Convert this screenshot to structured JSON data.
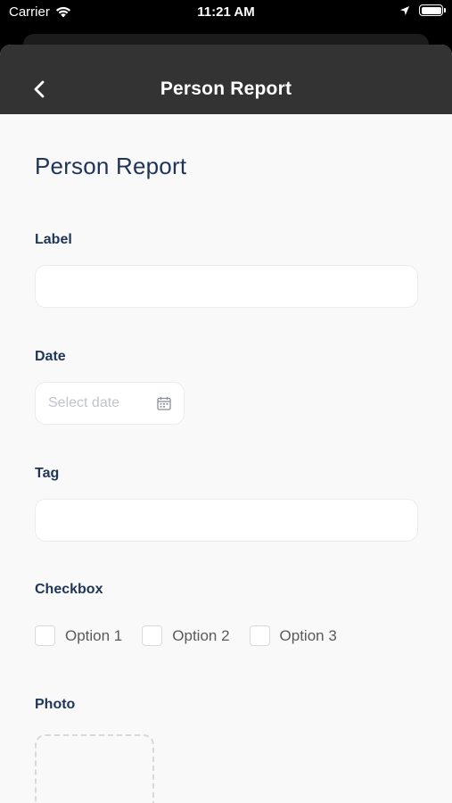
{
  "status_bar": {
    "carrier": "Carrier",
    "time": "11:21 AM"
  },
  "nav": {
    "title": "Person Report",
    "back_icon": "chevron-left-icon"
  },
  "form": {
    "title": "Person Report",
    "label": {
      "label": "Label",
      "value": ""
    },
    "date": {
      "label": "Date",
      "placeholder": "Select date",
      "icon": "calendar-icon"
    },
    "tag": {
      "label": "Tag",
      "value": ""
    },
    "checkbox": {
      "label": "Checkbox",
      "options": [
        {
          "label": "Option 1",
          "checked": false
        },
        {
          "label": "Option 2",
          "checked": false
        },
        {
          "label": "Option 3",
          "checked": false
        }
      ]
    },
    "photo": {
      "label": "Photo"
    }
  },
  "colors": {
    "nav_bg": "#333333",
    "heading": "#1e3557",
    "sheet_bg": "#f9f9f9"
  }
}
